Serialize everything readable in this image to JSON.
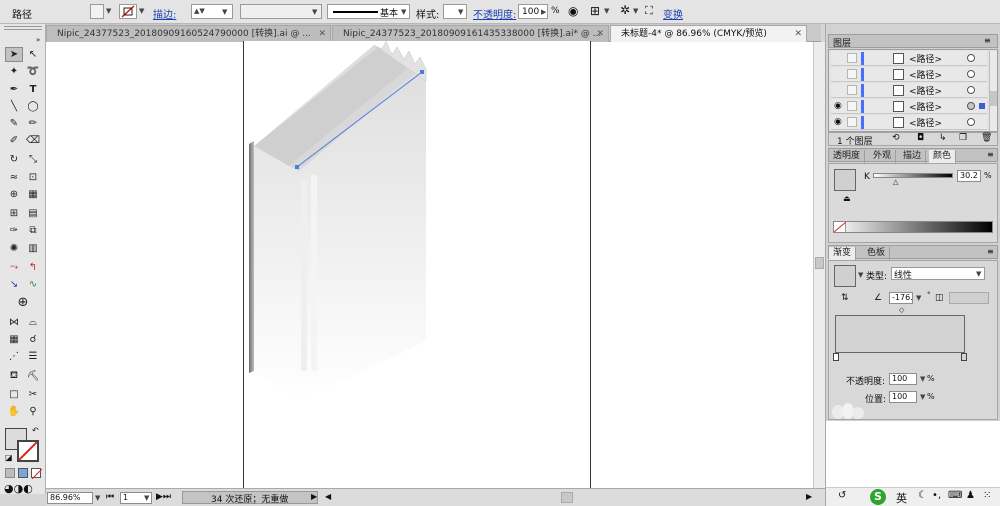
{
  "control_bar": {
    "selection_label": "路径",
    "stroke_label": "描边:",
    "stroke_profile": "基本",
    "style_label": "样式:",
    "opacity_label": "不透明度:",
    "opacity_value": "100",
    "opacity_unit": "%",
    "transform_label": "变换"
  },
  "tabs": [
    {
      "label": "Nipic_24377523_20180909160524790000  [转换].ai @ ...",
      "active": false
    },
    {
      "label": "Nipic_24377523_20180909161435338000  [转换].ai* @ ...",
      "active": false
    },
    {
      "label": "未标题-4* @ 86.96% (CMYK/预览)",
      "active": true
    }
  ],
  "status_bar": {
    "zoom": "86.96%",
    "page": "1",
    "history": "34 次还原；无重做"
  },
  "layers_panel": {
    "title": "图层",
    "rows": [
      {
        "label": "<路径>",
        "visible": false,
        "selected": false
      },
      {
        "label": "<路径>",
        "visible": false,
        "selected": false
      },
      {
        "label": "<路径>",
        "visible": false,
        "selected": false
      },
      {
        "label": "<路径>",
        "visible": true,
        "selected": true
      },
      {
        "label": "<路径>",
        "visible": true,
        "selected": false
      }
    ],
    "footer": "1 个图层"
  },
  "color_panel": {
    "tabs": [
      "透明度",
      "外观",
      "描边",
      "颜色"
    ],
    "active_tab": "颜色",
    "channel": "K",
    "channel_value": "30.2",
    "unit": "%"
  },
  "gradient_panel": {
    "tabs": [
      "渐变",
      "色板"
    ],
    "type_label": "类型:",
    "type_value": "线性",
    "angle_value": "-176.",
    "opacity_label": "不透明度:",
    "opacity_value": "100",
    "location_label": "位置:",
    "location_value": "100",
    "unit": "%"
  },
  "taskbar": {
    "ime_label": "英"
  },
  "colors": {
    "anchor_blue": "#4f7be0",
    "layer_blue": "#4a6cff",
    "link_blue": "#1a3fb0"
  }
}
